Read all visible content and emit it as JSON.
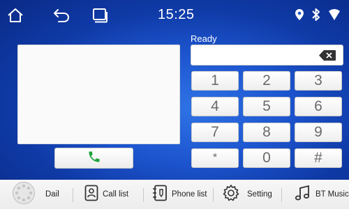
{
  "status_bar": {
    "clock": "15:25",
    "icons": [
      "home-icon",
      "back-icon",
      "recent-apps-icon",
      "location-icon",
      "bluetooth-icon",
      "wifi-icon"
    ]
  },
  "dialer": {
    "status_text": "Ready",
    "number_value": "",
    "keys": [
      "1",
      "2",
      "3",
      "4",
      "5",
      "6",
      "7",
      "8",
      "9",
      "*",
      "0",
      "#"
    ]
  },
  "nav": {
    "items": [
      {
        "label": "Dail",
        "icon": "dial-icon"
      },
      {
        "label": "Call list",
        "icon": "contact-card-icon"
      },
      {
        "label": "Phone list",
        "icon": "phonebook-icon"
      },
      {
        "label": "Setting",
        "icon": "gear-icon"
      },
      {
        "label": "BT Music",
        "icon": "music-note-icon"
      }
    ]
  },
  "colors": {
    "background_center": "#2f73e6",
    "background_edge": "#0a2a86",
    "call_green": "#1fa33a",
    "key_text": "#6a6a6a"
  }
}
